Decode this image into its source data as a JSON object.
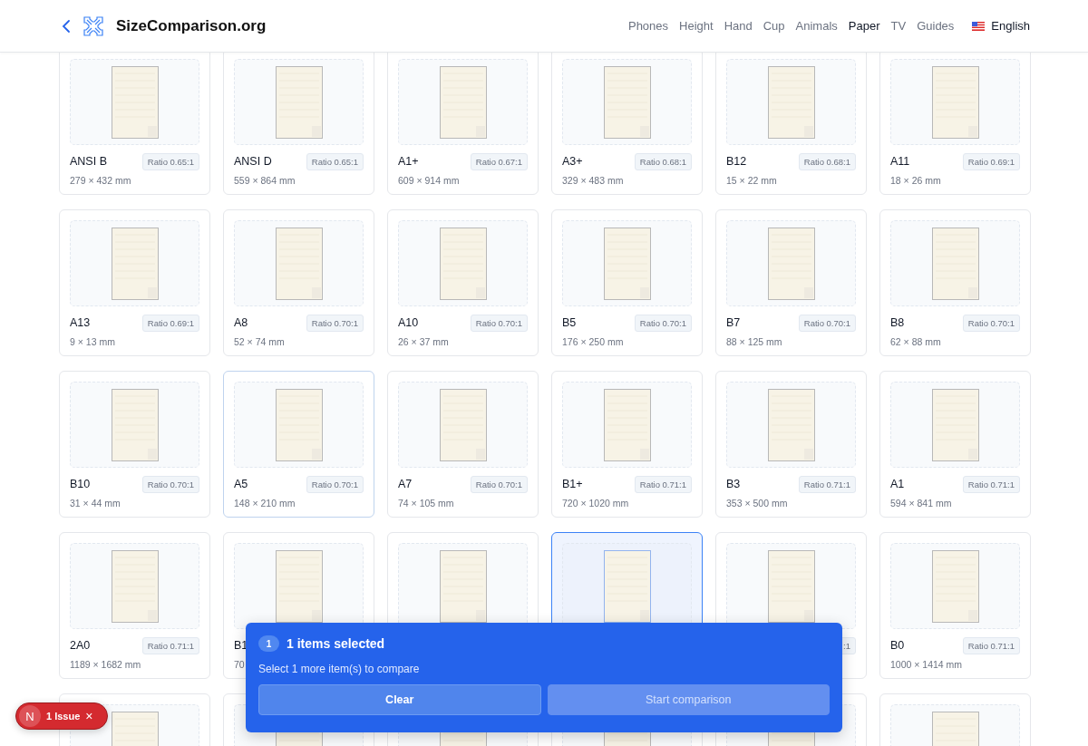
{
  "header": {
    "site_name": "SizeComparison.org",
    "nav": [
      {
        "label": "Phones",
        "selected": false
      },
      {
        "label": "Height",
        "selected": false
      },
      {
        "label": "Hand",
        "selected": false
      },
      {
        "label": "Cup",
        "selected": false
      },
      {
        "label": "Animals",
        "selected": false
      },
      {
        "label": "Paper",
        "selected": true
      },
      {
        "label": "TV",
        "selected": false
      },
      {
        "label": "Guides",
        "selected": false
      }
    ],
    "language": "English"
  },
  "cards": [
    {
      "name": "ANSI B",
      "ratio": "Ratio 0.65:1",
      "size": "279 × 432 mm",
      "selected": false,
      "highlighted": false
    },
    {
      "name": "ANSI D",
      "ratio": "Ratio 0.65:1",
      "size": "559 × 864 mm",
      "selected": false,
      "highlighted": false
    },
    {
      "name": "A1+",
      "ratio": "Ratio 0.67:1",
      "size": "609 × 914 mm",
      "selected": false,
      "highlighted": false
    },
    {
      "name": "A3+",
      "ratio": "Ratio 0.68:1",
      "size": "329 × 483 mm",
      "selected": false,
      "highlighted": false
    },
    {
      "name": "B12",
      "ratio": "Ratio 0.68:1",
      "size": "15 × 22 mm",
      "selected": false,
      "highlighted": false
    },
    {
      "name": "A11",
      "ratio": "Ratio 0.69:1",
      "size": "18 × 26 mm",
      "selected": false,
      "highlighted": false
    },
    {
      "name": "A13",
      "ratio": "Ratio 0.69:1",
      "size": "9 × 13 mm",
      "selected": false,
      "highlighted": false
    },
    {
      "name": "A8",
      "ratio": "Ratio 0.70:1",
      "size": "52 × 74 mm",
      "selected": false,
      "highlighted": false
    },
    {
      "name": "A10",
      "ratio": "Ratio 0.70:1",
      "size": "26 × 37 mm",
      "selected": false,
      "highlighted": false
    },
    {
      "name": "B5",
      "ratio": "Ratio 0.70:1",
      "size": "176 × 250 mm",
      "selected": false,
      "highlighted": false
    },
    {
      "name": "B7",
      "ratio": "Ratio 0.70:1",
      "size": "88 × 125 mm",
      "selected": false,
      "highlighted": false
    },
    {
      "name": "B8",
      "ratio": "Ratio 0.70:1",
      "size": "62 × 88 mm",
      "selected": false,
      "highlighted": false
    },
    {
      "name": "B10",
      "ratio": "Ratio 0.70:1",
      "size": "31 × 44 mm",
      "selected": false,
      "highlighted": false
    },
    {
      "name": "A5",
      "ratio": "Ratio 0.70:1",
      "size": "148 × 210 mm",
      "selected": false,
      "highlighted": true
    },
    {
      "name": "A7",
      "ratio": "Ratio 0.70:1",
      "size": "74 × 105 mm",
      "selected": false,
      "highlighted": false
    },
    {
      "name": "B1+",
      "ratio": "Ratio 0.71:1",
      "size": "720 × 1020 mm",
      "selected": false,
      "highlighted": false
    },
    {
      "name": "B3",
      "ratio": "Ratio 0.71:1",
      "size": "353 × 500 mm",
      "selected": false,
      "highlighted": false
    },
    {
      "name": "A1",
      "ratio": "Ratio 0.71:1",
      "size": "594 × 841 mm",
      "selected": false,
      "highlighted": false
    },
    {
      "name": "2A0",
      "ratio": "Ratio 0.71:1",
      "size": "1189 × 1682 mm",
      "selected": false,
      "highlighted": false
    },
    {
      "name": "B1",
      "size": "70",
      "selected": false,
      "highlighted": false
    },
    {
      "selected": false,
      "highlighted": false
    },
    {
      "selected": true,
      "highlighted": false
    },
    {
      "ratio": ":1",
      "selected": false,
      "highlighted": false
    },
    {
      "name": "B0",
      "ratio": "Ratio 0.71:1",
      "size": "1000 × 1414 mm",
      "selected": false,
      "highlighted": false
    },
    {
      "selected": false,
      "highlighted": false
    },
    {
      "selected": false,
      "highlighted": false
    },
    {
      "selected": false,
      "highlighted": false
    },
    {
      "selected": false,
      "highlighted": false
    },
    {
      "selected": false,
      "highlighted": false
    },
    {
      "selected": false,
      "highlighted": false
    }
  ],
  "selection_panel": {
    "count": "1",
    "title": "1 items selected",
    "hint": "Select 1 more item(s) to compare",
    "buttons": [
      {
        "label": "Clear",
        "disabled": false
      },
      {
        "label": "Start comparison",
        "disabled": true
      }
    ]
  },
  "issues_badge": {
    "letter": "N",
    "label": "1 Issue",
    "close": "×"
  }
}
